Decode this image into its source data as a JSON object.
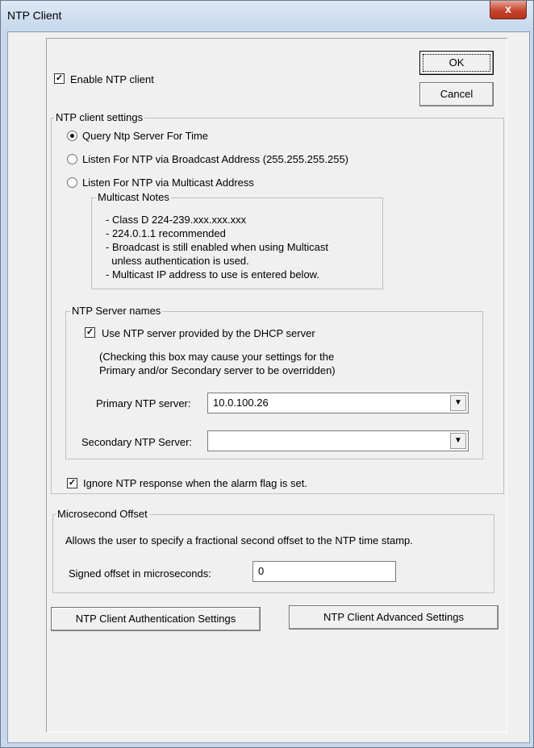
{
  "window": {
    "title": "NTP Client",
    "close_label": "x"
  },
  "buttons": {
    "ok": "OK",
    "cancel": "Cancel",
    "auth": "NTP Client Authentication Settings",
    "advanced": "NTP Client Advanced Settings"
  },
  "enable_client": {
    "label": "Enable NTP client",
    "checked": true
  },
  "settings_group": {
    "legend": "NTP client settings",
    "radio_query": "Query Ntp Server For Time",
    "radio_broadcast": "Listen For NTP via Broadcast Address (255.255.255.255)",
    "radio_multicast": "Listen For NTP via Multicast Address",
    "selected": "query"
  },
  "multicast_notes": {
    "legend": "Multicast Notes",
    "lines": [
      "- Class D 224-239.xxx.xxx.xxx",
      "- 224.0.1.1 recommended",
      "- Broadcast is still enabled when using Multicast",
      "  unless authentication is used.",
      "- Multicast IP address to use is entered below."
    ]
  },
  "server_names": {
    "legend": "NTP Server names",
    "dhcp_label": "Use NTP server provided by the DHCP server",
    "dhcp_checked": true,
    "note_line1": "(Checking this box may cause your settings for the",
    "note_line2": "Primary and/or Secondary server to be overridden)",
    "primary_label": "Primary NTP server:",
    "primary_value": "10.0.100.26",
    "secondary_label": "Secondary NTP Server:",
    "secondary_value": ""
  },
  "ignore_alarm": {
    "label": "Ignore NTP response when the alarm flag is set.",
    "checked": true
  },
  "microsecond": {
    "legend": "Microsecond Offset",
    "description": "Allows the user to specify a fractional second offset to the NTP time stamp.",
    "offset_label": "Signed offset in microseconds:",
    "offset_value": "0"
  },
  "icons": {
    "check": "checkmark-icon",
    "dropdown": "chevron-down-icon",
    "close": "close-icon"
  }
}
